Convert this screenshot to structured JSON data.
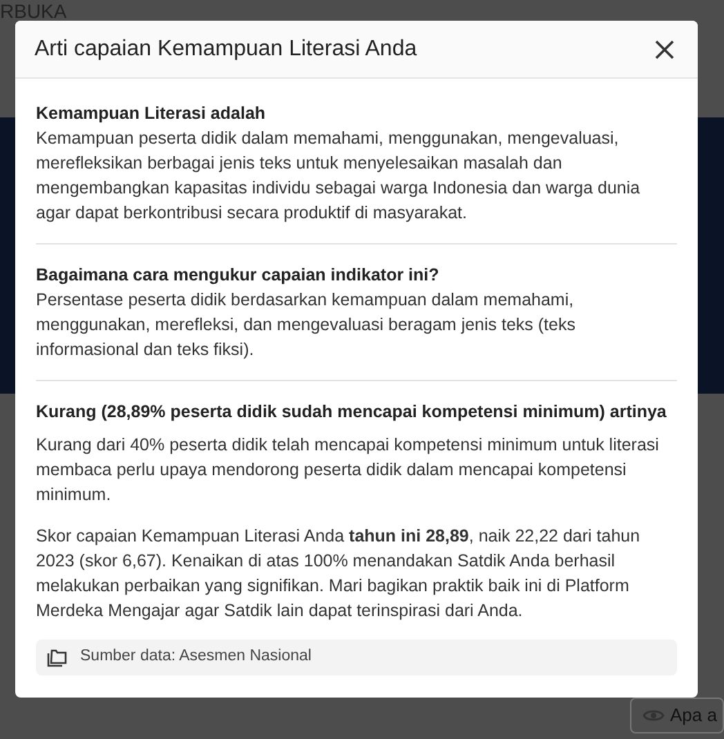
{
  "background": {
    "header_text": "RBUKA",
    "button_label": "Apa a"
  },
  "modal": {
    "title": "Arti capaian Kemampuan Literasi Anda",
    "sections": [
      {
        "heading": "Kemampuan Literasi adalah",
        "paragraphs": [
          "Kemampuan peserta didik dalam memahami, menggunakan, mengevaluasi, merefleksikan berbagai jenis teks untuk menyelesaikan masalah dan mengembangkan kapasitas individu sebagai warga Indonesia dan warga dunia agar dapat berkontribusi secara produktif di masyarakat."
        ]
      },
      {
        "heading": "Bagaimana cara mengukur capaian indikator ini?",
        "paragraphs": [
          "Persentase peserta didik berdasarkan kemampuan dalam memahami, menggunakan, merefleksi, dan mengevaluasi beragam jenis teks (teks informasional dan teks fiksi)."
        ]
      },
      {
        "heading": "Kurang (28,89% peserta didik sudah mencapai kompetensi minimum) artinya",
        "paragraphs": [
          "Kurang dari 40% peserta didik telah mencapai kompetensi minimum untuk literasi membaca perlu upaya mendorong peserta didik dalam mencapai kompetensi minimum.",
          "Skor capaian Kemampuan Literasi Anda **tahun ini 28,89**, naik 22,22 dari tahun 2023 (skor 6,67). Kenaikan di atas 100% menandakan Satdik Anda berhasil melakukan perbaikan yang signifikan. Mari bagikan praktik baik ini di Platform Merdeka Mengajar agar Satdik lain dapat terinspirasi dari Anda."
        ]
      }
    ],
    "source": "Sumber data: Asesmen Nasional"
  }
}
